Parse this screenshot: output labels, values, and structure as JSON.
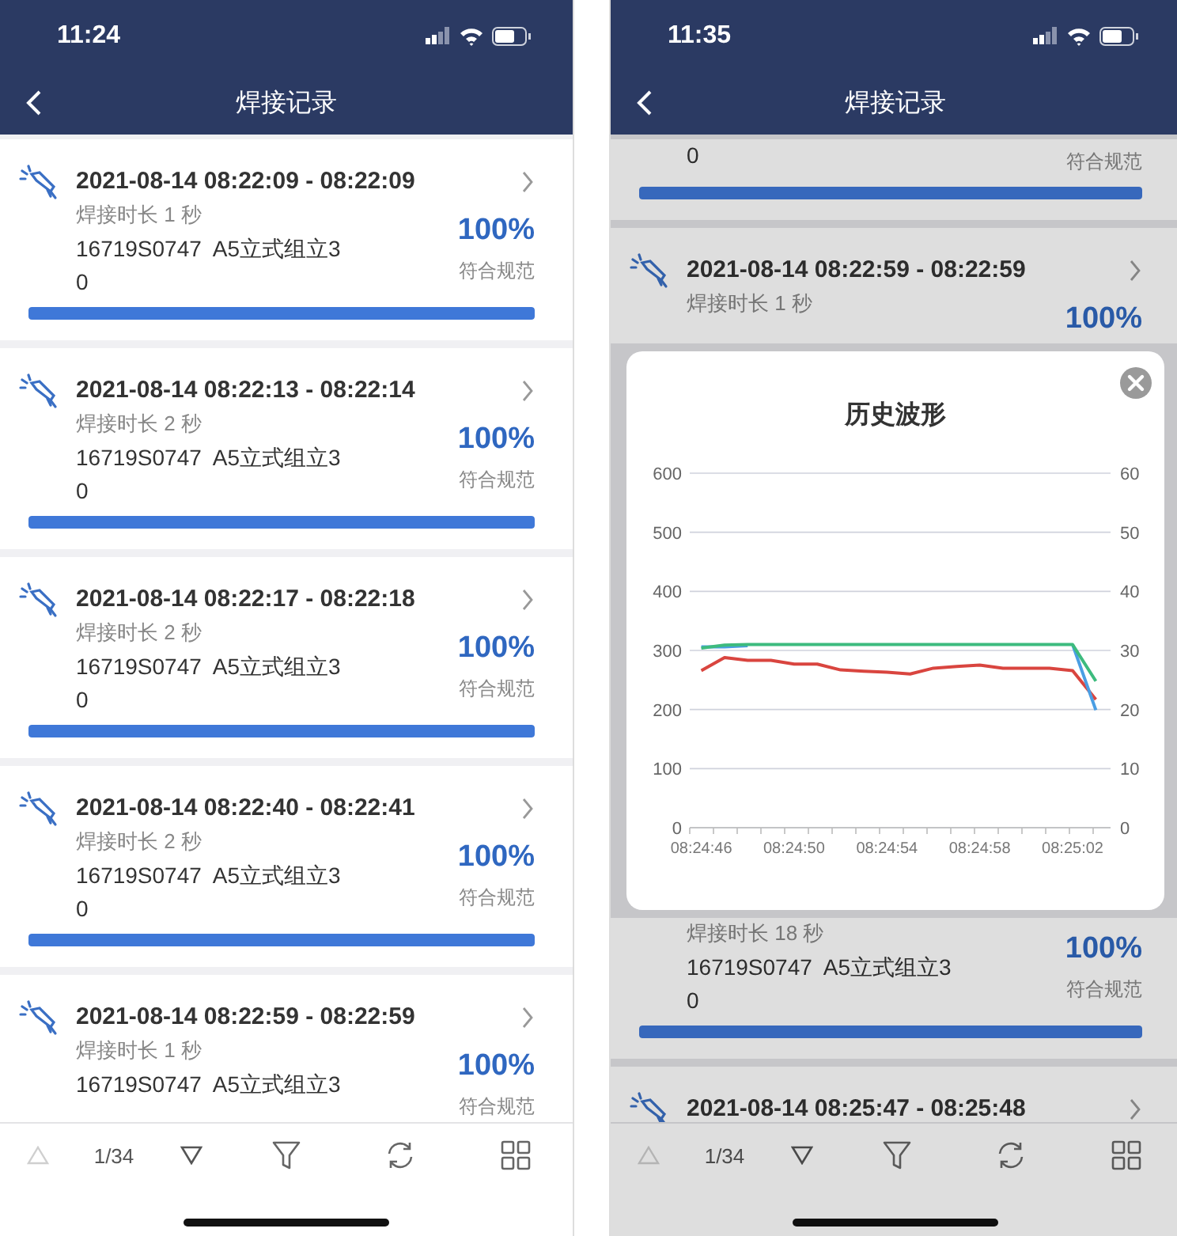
{
  "screens": [
    {
      "status_bar": {
        "time": "11:24"
      },
      "header": {
        "title": "焊接记录"
      },
      "dimmed": false,
      "records": [
        {
          "time_range": "2021-08-14 08:22:09 - 08:22:09",
          "duration": "焊接时长 1 秒",
          "part": "16719S0747  A5立式组立3",
          "part_cont": "0",
          "percent": "100%",
          "status": "符合规范",
          "level": 1
        },
        {
          "time_range": "2021-08-14 08:22:13 - 08:22:14",
          "duration": "焊接时长 2 秒",
          "part": "16719S0747  A5立式组立3",
          "part_cont": "0",
          "percent": "100%",
          "status": "符合规范",
          "level": 1
        },
        {
          "time_range": "2021-08-14 08:22:17 - 08:22:18",
          "duration": "焊接时长 2 秒",
          "part": "16719S0747  A5立式组立3",
          "part_cont": "0",
          "percent": "100%",
          "status": "符合规范",
          "level": 1
        },
        {
          "time_range": "2021-08-14 08:22:40 - 08:22:41",
          "duration": "焊接时长 2 秒",
          "part": "16719S0747  A5立式组立3",
          "part_cont": "0",
          "percent": "100%",
          "status": "符合规范",
          "level": 1
        },
        {
          "time_range": "2021-08-14 08:22:59 - 08:22:59",
          "duration": "焊接时长 1 秒",
          "part": "16719S0747  A5立式组立3",
          "percent": "100%",
          "status": "符合规范"
        }
      ],
      "toolbar": {
        "page": "1/34",
        "prev_disabled": true
      }
    },
    {
      "status_bar": {
        "time": "11:35"
      },
      "header": {
        "title": "焊接记录"
      },
      "dimmed": true,
      "records": [
        {
          "part_cont": "0",
          "status": "符合规范",
          "level": 1
        },
        {
          "time_range": "2021-08-14 08:22:59 - 08:22:59",
          "duration": "焊接时长 1 秒",
          "percent": "100%"
        },
        {
          "duration": "焊接时长 18 秒",
          "part": "16719S0747  A5立式组立3",
          "part_cont": "0",
          "percent": "100%",
          "status": "符合规范",
          "level": 1
        },
        {
          "time_range": "2021-08-14 08:25:47 - 08:25:48"
        }
      ],
      "dialog": {
        "title": "历史波形",
        "chart_data": {
          "type": "line",
          "categories": [
            "08:24:46",
            null,
            null,
            null,
            "08:24:50",
            null,
            null,
            null,
            "08:24:54",
            null,
            null,
            null,
            "08:24:58",
            null,
            null,
            null,
            "08:25:02",
            null
          ],
          "series": [
            {
              "color": "#d9453f",
              "values": [
                266,
                288,
                283,
                283,
                277,
                277,
                267,
                265,
                263,
                260,
                270,
                273,
                275,
                270,
                270,
                270,
                266,
                217
              ]
            },
            {
              "color": "#4a9ee3",
              "values": [
                306,
                306,
                308,
                null,
                null,
                null,
                null,
                null,
                null,
                null,
                null,
                null,
                null,
                null,
                null,
                null,
                310,
                199
              ]
            },
            {
              "color": "#3dbb7e",
              "values": [
                304,
                309,
                310,
                310,
                310,
                310,
                310,
                310,
                310,
                310,
                310,
                310,
                310,
                310,
                310,
                310,
                310,
                248
              ]
            }
          ],
          "ylim": [
            0,
            600
          ],
          "yticks": [
            0,
            100,
            200,
            300,
            400,
            500,
            600
          ],
          "grid": true,
          "annotations": [
            "0",
            "10",
            "20",
            "30",
            "40",
            "50",
            "60"
          ]
        }
      },
      "toolbar": {
        "page": "1/34",
        "prev_disabled": true
      }
    }
  ]
}
